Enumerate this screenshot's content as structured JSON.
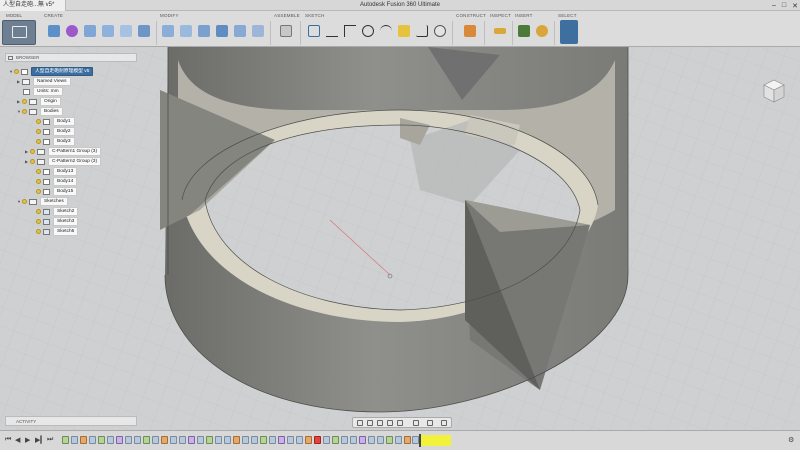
{
  "window": {
    "tab_title": "人型自走砲...無 v5*",
    "app_title": "Autodesk Fusion 360 Ultimate",
    "minimize": "–",
    "maximize": "□",
    "close": "✕"
  },
  "ribbon": {
    "workspace": "MODEL",
    "groups": {
      "create": "CREATE",
      "modify": "MODIFY",
      "assemble": "ASSEMBLE",
      "sketch": "SKETCH",
      "construct": "CONSTRUCT",
      "inspect": "INSPECT",
      "insert": "INSERT",
      "select": "SELECT"
    }
  },
  "browser": {
    "title": "BROWSER",
    "root": "人型自走砲劍原理模型 v5",
    "items": [
      {
        "label": "Named Views"
      },
      {
        "label": "Units: mm"
      },
      {
        "label": "Origin"
      },
      {
        "label": "Bodies"
      },
      {
        "label": "Body1"
      },
      {
        "label": "Body2"
      },
      {
        "label": "Body3"
      },
      {
        "label": "C-Pattern1 Group (3)"
      },
      {
        "label": "C-Pattern2 Group (3)"
      },
      {
        "label": "Body13"
      },
      {
        "label": "Body14"
      },
      {
        "label": "Body15"
      },
      {
        "label": "Sketches"
      },
      {
        "label": "Sketch2"
      },
      {
        "label": "Sketch3"
      },
      {
        "label": "Sketch5"
      }
    ]
  },
  "activity": {
    "title": "ACTIVITY"
  },
  "colors": {
    "accent": "#3c6fa0",
    "body_fill": "#8a8a87",
    "body_dark": "#6a6a67",
    "body_light": "#b8b6ac",
    "inner_surface": "#d8d4c6",
    "grid": "#bdbfc2",
    "timeline_highlight": "#f2f23a"
  },
  "icons": {
    "browser_collapse": "collapse-icon",
    "activity_collapse": "collapse-icon",
    "viewcube": "viewcube-icon",
    "timeline_settings": "gear-icon"
  }
}
